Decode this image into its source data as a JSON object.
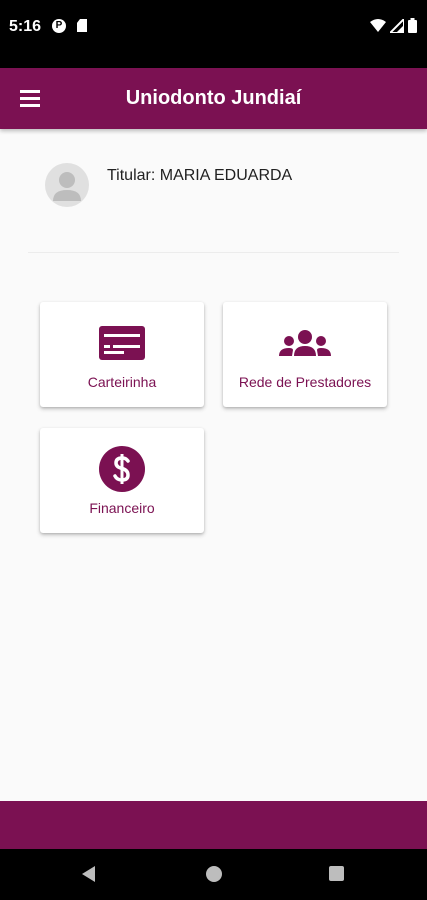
{
  "status_bar": {
    "time": "5:16",
    "left_icons": [
      "p-badge-icon",
      "sd-card-icon"
    ],
    "right_icons": [
      "wifi-icon",
      "signal-icon",
      "battery-icon"
    ]
  },
  "app_bar": {
    "title": "Uniodonto Jundiaí",
    "menu_icon": "menu-icon"
  },
  "profile": {
    "titular_label": "Titular: MARIA EDUARDA",
    "avatar_icon": "person-icon"
  },
  "cards": [
    {
      "label": "Carteirinha",
      "icon": "id-card-icon"
    },
    {
      "label": "Rede de Prestadores",
      "icon": "group-icon"
    },
    {
      "label": "Financeiro",
      "icon": "dollar-circle-icon"
    }
  ],
  "colors": {
    "primary": "#7b1152",
    "background": "#fafafa",
    "card": "#ffffff"
  },
  "nav_bar": {
    "icons": [
      "back-icon",
      "home-icon",
      "recents-icon"
    ]
  }
}
